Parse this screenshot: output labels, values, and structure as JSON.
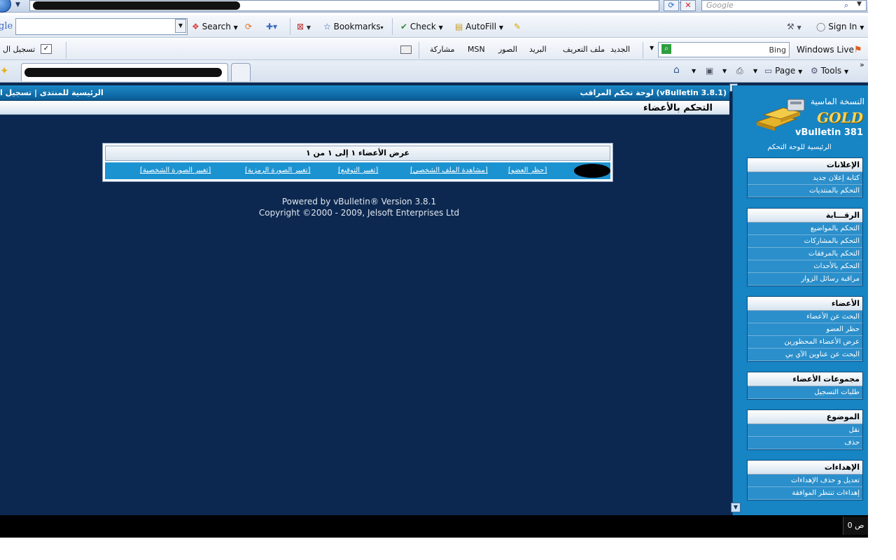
{
  "address_bar": {
    "search_placeholder": "Google"
  },
  "google_toolbar": {
    "label": "gle",
    "search": "Search",
    "bookmarks": "Bookmarks",
    "check": "Check",
    "autofill": "AutoFill",
    "sign_in": "Sign In"
  },
  "live_toolbar": {
    "register": "تسجيل ال",
    "windows_live": "Windows Live",
    "bing": "Bing",
    "links": [
      "الجديد",
      "ملف التعريف",
      "البريد",
      "الصور",
      "MSN",
      "مشاركة"
    ]
  },
  "command_bar": {
    "page": "Page",
    "tools": "Tools"
  },
  "vb": {
    "nav_left": "الرئيسية للمنتدى | تسجيل ا",
    "nav_right": "لوحة تحكم المراقب (vBulletin 3.8.1)",
    "page_title": "التحكم بالأعضاء",
    "results_header": "عرض الأعضاء ١ إلى ١ من ١",
    "row_links": [
      "[حظر العضو]",
      "[مشاهدة الملف الشخصي]",
      "[تغيير التوقيع]",
      "[تغيير الصورة الرمزية]",
      "[تغيير الصورة الشخصية]"
    ],
    "powered_line1": "Powered by vBulletin® Version 3.8.1",
    "powered_line2": "Copyright ©2000 - 2009, Jelsoft Enterprises Ltd"
  },
  "sidebar": {
    "logo_top": "النسخة الماسية",
    "logo_gold": "GOLD",
    "logo_vb": "vBulletin 381",
    "home": "الرئيسية للوحة التحكم",
    "groups": [
      {
        "title": "الإعلانات",
        "items": [
          "كتابة إعلان جديد",
          "التحكم بالمنتديات"
        ]
      },
      {
        "title": "الرقـــابة",
        "items": [
          "التحكم بالمواضيع",
          "التحكم بالمشاركات",
          "التحكم بالمرفقات",
          "التحكم بالأحداث",
          "مراقبة رسائل الزوار"
        ]
      },
      {
        "title": "الأعضاء",
        "items": [
          "البحث عن الأعضاء",
          "حظر العضو",
          "عرض الأعضاء المحظورين",
          "البحث عن عناوين الآي بي"
        ]
      },
      {
        "title": "مجموعات الأعضاء",
        "items": [
          "طلبات التسجيل"
        ]
      },
      {
        "title": "الموضوع",
        "items": [
          "نقل",
          "حذف"
        ]
      },
      {
        "title": "الإهداءات",
        "items": [
          "تعديل و حذف الإهداءات",
          "إهداءات تنتظر الموافقة"
        ]
      }
    ]
  },
  "taskbar": {
    "clock": "ص 0"
  }
}
